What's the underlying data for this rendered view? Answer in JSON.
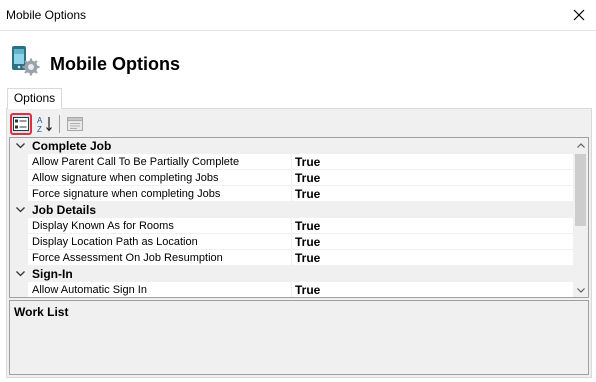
{
  "window": {
    "title": "Mobile Options",
    "close_icon": "close-icon"
  },
  "header": {
    "title": "Mobile Options",
    "icon": "mobile-settings-icon"
  },
  "tabs": [
    {
      "label": "Options"
    }
  ],
  "toolbar": {
    "categorized_icon": "categorized-view-icon",
    "alphabetical_icon": "alphabetical-sort-icon",
    "property_pages_icon": "property-pages-icon"
  },
  "grid": {
    "categories": [
      {
        "name": "Complete Job",
        "properties": [
          {
            "name": "Allow Parent Call To Be Partially Complete",
            "value": "True"
          },
          {
            "name": "Allow signature when completing Jobs",
            "value": "True"
          },
          {
            "name": "Force signature when completing Jobs",
            "value": "True"
          }
        ]
      },
      {
        "name": "Job Details",
        "properties": [
          {
            "name": "Display Known As for Rooms",
            "value": "True"
          },
          {
            "name": "Display Location Path as Location",
            "value": "True"
          },
          {
            "name": "Force Assessment On Job Resumption",
            "value": "True"
          }
        ]
      },
      {
        "name": "Sign-In",
        "properties": [
          {
            "name": "Allow Automatic Sign In",
            "value": "True"
          }
        ]
      }
    ]
  },
  "description": {
    "title": "Work List"
  },
  "colors": {
    "highlight_border": "#d9333f",
    "highlight_fill": "#cfe3f8",
    "panel_bg": "#f0f0f0"
  }
}
